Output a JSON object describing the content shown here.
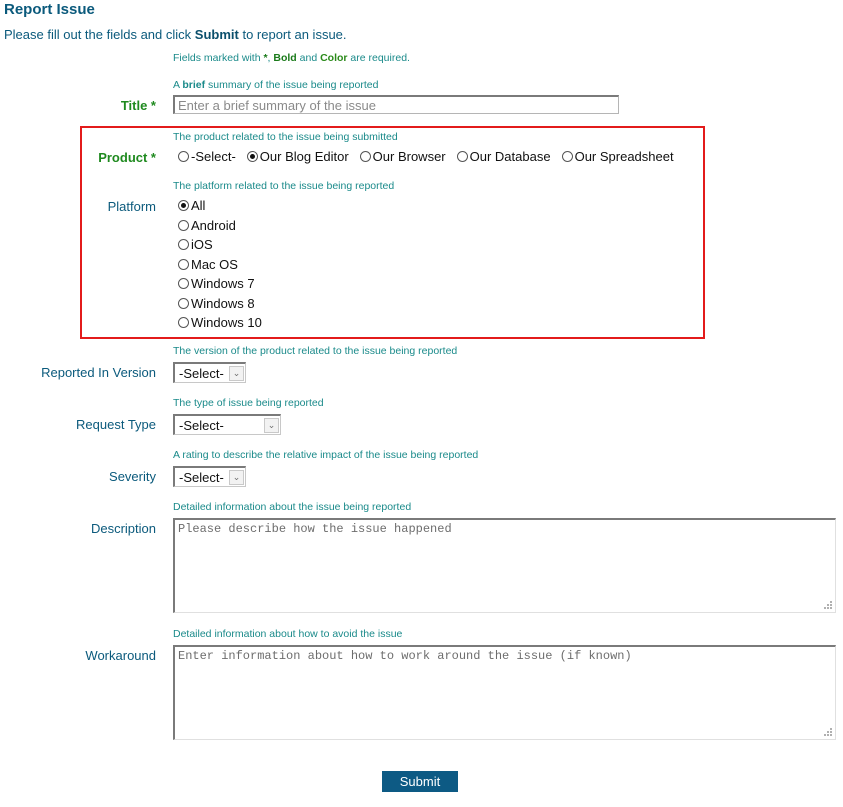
{
  "page": {
    "title": "Report Issue",
    "intro_prefix": "Please fill out the fields and click ",
    "intro_bold": "Submit",
    "intro_suffix": " to report an issue.",
    "required_legend": {
      "prefix": "Fields marked with ",
      "star": "*",
      "sep": ", ",
      "bold": "Bold",
      "and": " and ",
      "color": "Color",
      "suffix": " are required."
    }
  },
  "fields": {
    "title": {
      "label": "Title *",
      "hint_prefix": "A ",
      "hint_bold": "brief",
      "hint_suffix": " summary of the issue being reported",
      "placeholder": "Enter a brief summary of the issue"
    },
    "product": {
      "label": "Product *",
      "hint": "The product related to the issue being submitted",
      "options": [
        "-Select-",
        "Our Blog Editor",
        "Our Browser",
        "Our Database",
        "Our Spreadsheet"
      ],
      "selected": "Our Blog Editor"
    },
    "platform": {
      "label": "Platform",
      "hint": "The platform related to the issue being reported",
      "options": [
        "All",
        "Android",
        "iOS",
        "Mac OS",
        "Windows 7",
        "Windows 8",
        "Windows 10"
      ],
      "selected": "All"
    },
    "reported_in_version": {
      "label": "Reported In Version",
      "hint": "The version of the product related to the issue being reported",
      "value": "-Select-"
    },
    "request_type": {
      "label": "Request Type",
      "hint": "The type of issue being reported",
      "value": "-Select-"
    },
    "severity": {
      "label": "Severity",
      "hint": "A rating to describe the relative impact of the issue being reported",
      "value": "-Select-"
    },
    "description": {
      "label": "Description",
      "hint": "Detailed information about the issue being reported",
      "placeholder": "Please describe how the issue happened"
    },
    "workaround": {
      "label": "Workaround",
      "hint": "Detailed information about how to avoid the issue",
      "placeholder": "Enter information about how to work around the issue (if known)"
    }
  },
  "actions": {
    "submit_label": "Submit"
  },
  "colors": {
    "heading": "#0b5a7c",
    "hint": "#1a8a8a",
    "required": "#1f8a1f",
    "highlight_box": "#e31b1b",
    "submit_bg": "#0d5a84"
  }
}
